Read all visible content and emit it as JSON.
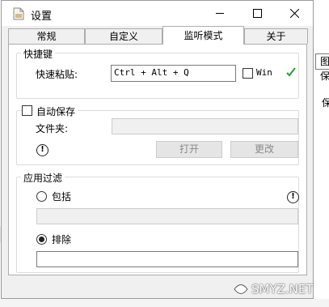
{
  "window": {
    "title": "设置"
  },
  "tabs": [
    {
      "label": "常规",
      "active": false
    },
    {
      "label": "自定义",
      "active": false
    },
    {
      "label": "监听模式",
      "active": true
    },
    {
      "label": "关于",
      "active": false
    }
  ],
  "hotkey_group": {
    "legend": "快捷键",
    "paste_label": "快速粘贴:",
    "hotkey_value": "Ctrl + Alt + Q",
    "win_label": "Win",
    "win_checked": false,
    "status_icon": "green-check-icon"
  },
  "autosave_group": {
    "label": "自动保存",
    "checked": false,
    "folder_label": "文件夹:",
    "folder_value": "",
    "open_button": "打开",
    "change_button": "更改"
  },
  "filter_group": {
    "legend": "应用过滤",
    "include_label": "包括",
    "include_selected": false,
    "include_value": "",
    "exclude_label": "排除",
    "exclude_selected": true,
    "exclude_value": ""
  },
  "background": {
    "fragment_1": "图",
    "fragment_2": "保",
    "fragment_3": "保"
  },
  "watermark": {
    "text": "SMYZ.NET"
  },
  "colors": {
    "check_green": "#2e9a2e",
    "panel_bg": "#ffffff",
    "window_bg": "#f0f0f0"
  }
}
